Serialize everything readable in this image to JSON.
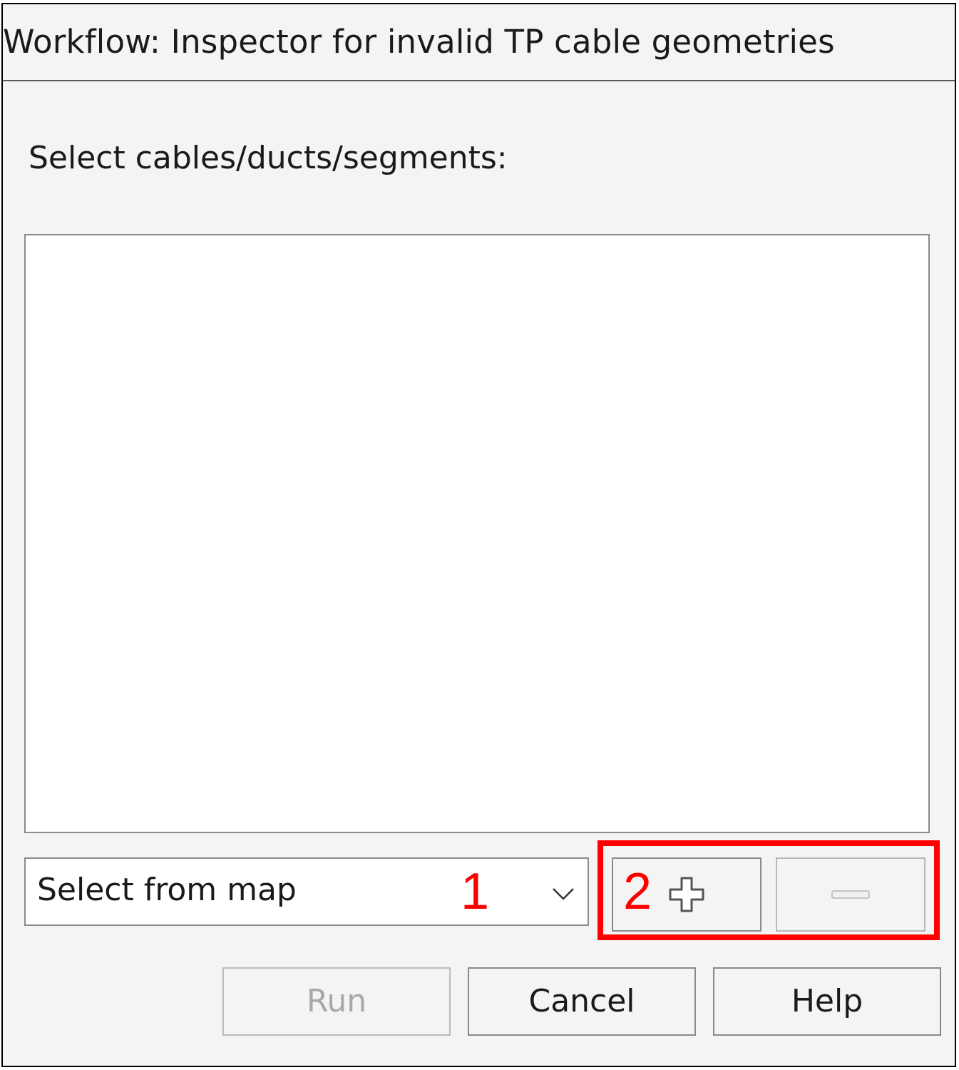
{
  "dialog": {
    "title": "Workflow: Inspector for invalid TP cable geometries"
  },
  "main": {
    "section_label": "Select cables/ducts/segments:",
    "selection_list": []
  },
  "selector": {
    "value": "Select from map",
    "icon": "chevron-down-icon"
  },
  "list_buttons": {
    "add_icon": "plus-icon",
    "remove_icon": "minus-icon"
  },
  "annotations": {
    "marker_1": "1",
    "marker_2": "2",
    "color": "#ff0000"
  },
  "footer": {
    "run_label": "Run",
    "cancel_label": "Cancel",
    "help_label": "Help"
  }
}
